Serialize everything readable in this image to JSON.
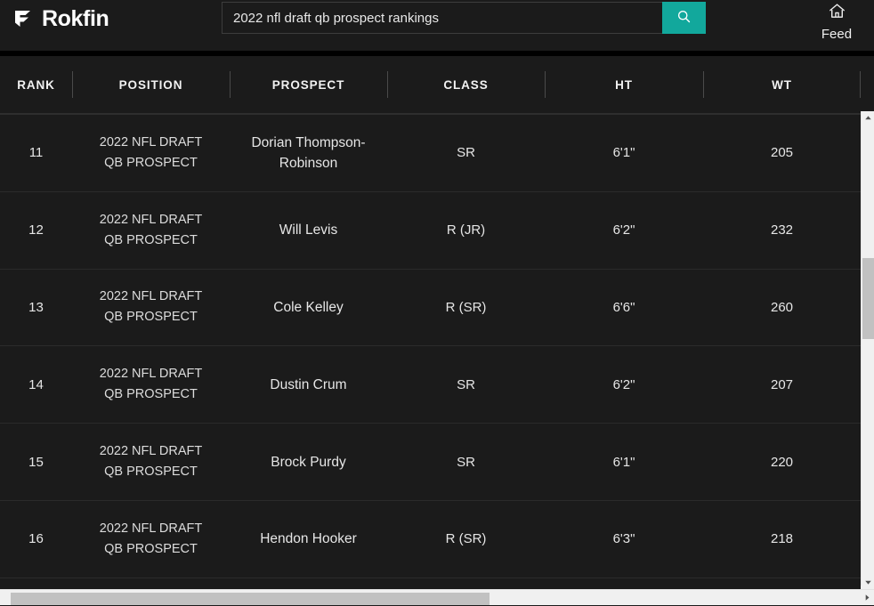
{
  "header": {
    "brand_name": "Rokfin",
    "brand_mark_icon": "rokfin-logo-icon",
    "search": {
      "value": "2022 nfl draft qb prospect rankings",
      "placeholder": "Search",
      "button_icon": "search-icon"
    },
    "feed": {
      "label": "Feed",
      "icon": "home-icon"
    }
  },
  "table": {
    "columns": [
      {
        "key": "rank",
        "label": "RANK"
      },
      {
        "key": "position",
        "label": "POSITION"
      },
      {
        "key": "prospect",
        "label": "PROSPECT"
      },
      {
        "key": "class",
        "label": "CLASS"
      },
      {
        "key": "ht",
        "label": "HT"
      },
      {
        "key": "wt",
        "label": "WT"
      }
    ],
    "rows": [
      {
        "rank": "11",
        "position_line1": "2022 NFL DRAFT",
        "position_line2": "QB PROSPECT",
        "prospect": "Dorian Thompson-Robinson",
        "class": "SR",
        "ht": "6'1\"",
        "wt": "205"
      },
      {
        "rank": "12",
        "position_line1": "2022 NFL DRAFT",
        "position_line2": "QB PROSPECT",
        "prospect": "Will Levis",
        "class": "R (JR)",
        "ht": "6'2\"",
        "wt": "232"
      },
      {
        "rank": "13",
        "position_line1": "2022 NFL DRAFT",
        "position_line2": "QB PROSPECT",
        "prospect": "Cole Kelley",
        "class": "R (SR)",
        "ht": "6'6\"",
        "wt": "260"
      },
      {
        "rank": "14",
        "position_line1": "2022 NFL DRAFT",
        "position_line2": "QB PROSPECT",
        "prospect": "Dustin Crum",
        "class": "SR",
        "ht": "6'2\"",
        "wt": "207"
      },
      {
        "rank": "15",
        "position_line1": "2022 NFL DRAFT",
        "position_line2": "QB PROSPECT",
        "prospect": "Brock Purdy",
        "class": "SR",
        "ht": "6'1\"",
        "wt": "220"
      },
      {
        "rank": "16",
        "position_line1": "2022 NFL DRAFT",
        "position_line2": "QB PROSPECT",
        "prospect": "Hendon Hooker",
        "class": "R (SR)",
        "ht": "6'3\"",
        "wt": "218"
      }
    ]
  },
  "scrollbars": {
    "vertical": {
      "up_arrow_icon": "triangle-up-icon",
      "down_arrow_icon": "triangle-down-icon"
    },
    "horizontal": {
      "right_arrow_icon": "triangle-right-icon"
    }
  },
  "colors": {
    "accent_teal": "#12a89c",
    "page_bg": "#1b1b1b",
    "text_primary": "#e6e6e6",
    "scrollbar_thumb": "#c1c1c1"
  }
}
